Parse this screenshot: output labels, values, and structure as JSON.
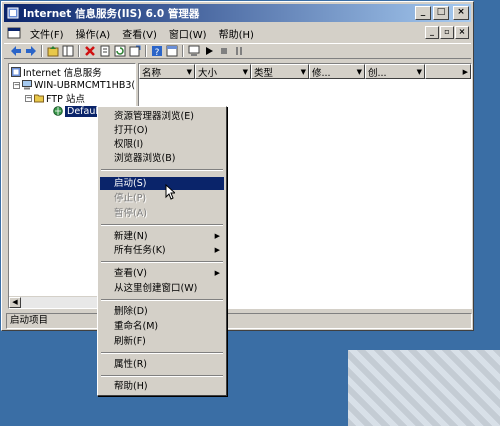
{
  "window": {
    "title": "Internet 信息服务(IIS) 6.0 管理器",
    "buttons": {
      "minimize": "_",
      "maximize": "□",
      "close": "×"
    }
  },
  "menubar": {
    "items": [
      "文件(F)",
      "操作(A)",
      "查看(V)",
      "窗口(W)",
      "帮助(H)"
    ],
    "mdi_buttons": {
      "minimize": "_",
      "restore": "▫",
      "close": "×"
    }
  },
  "toolbar": {
    "tools": [
      "back-icon",
      "forward-icon",
      "up-icon",
      "show-tree-icon",
      "delete-icon",
      "properties-icon",
      "refresh-icon",
      "export-icon",
      "help-icon",
      "console-icon",
      "computer-icon",
      "play-icon",
      "stop-icon",
      "pause-icon"
    ]
  },
  "tree": {
    "items": [
      {
        "label": "Internet 信息服务",
        "icon": "iis-icon"
      },
      {
        "label": "WIN-UBRMCMT1HB3(",
        "icon": "computer-icon",
        "expander": "−"
      },
      {
        "label": "FTP 站点",
        "icon": "folder-icon",
        "expander": "−"
      },
      {
        "label": "Default FTP",
        "icon": "ftp-site-icon"
      }
    ],
    "scroll_left": "◀",
    "scroll_right": "▶"
  },
  "list": {
    "columns": [
      "名称",
      "大小",
      "类型",
      "修...",
      "创..."
    ]
  },
  "statusbar": {
    "text": "启动项目"
  },
  "context_menu": {
    "items": [
      {
        "label": "资源管理器浏览(E)"
      },
      {
        "label": "打开(O)"
      },
      {
        "label": "权限(I)"
      },
      {
        "label": "浏览器浏览(B)"
      },
      {
        "label": "启动(S)",
        "highlighted": true
      },
      {
        "label": "停止(P)",
        "disabled": true
      },
      {
        "label": "暂停(A)",
        "disabled": true
      },
      {
        "label": "新建(N)",
        "submenu": "▶"
      },
      {
        "label": "所有任务(K)",
        "submenu": "▶"
      },
      {
        "label": "查看(V)",
        "submenu": "▶"
      },
      {
        "label": "从这里创建窗口(W)"
      },
      {
        "label": "删除(D)"
      },
      {
        "label": "重命名(M)"
      },
      {
        "label": "刷新(F)"
      },
      {
        "label": "属性(R)"
      },
      {
        "label": "帮助(H)"
      }
    ]
  },
  "colors": {
    "desktop": "#3a6ea5",
    "titlebar_start": "#0a246a",
    "titlebar_end": "#a6caf0",
    "highlight": "#0a246a",
    "face": "#d4d0c8"
  }
}
